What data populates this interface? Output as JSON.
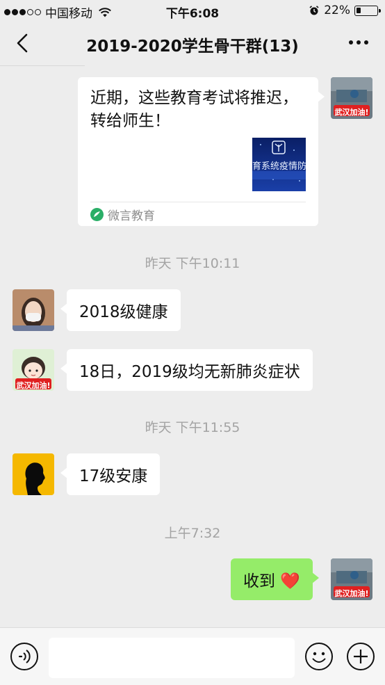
{
  "status_bar": {
    "carrier": "中国移动",
    "time": "下午6:08",
    "battery_text": "22%",
    "battery_level": 0.22
  },
  "nav": {
    "title": "2019-2020学生骨干群(13)"
  },
  "messages": {
    "card": {
      "title": "近期，这些教育考试将推迟，转给师生！",
      "thumb_text": "育系统疫情防",
      "source": "微言教育"
    },
    "timestamp_1": "昨天 下午10:11",
    "msg_1": "2018级健康",
    "msg_2": "18日，2019级均无新肺炎症状",
    "timestamp_2": "昨天 下午11:55",
    "msg_3": "17级安康",
    "timestamp_3": "上午7:32",
    "msg_4": "收到 ❤️",
    "avatar_badge": "武汉加油!"
  },
  "colors": {
    "chat_background": "#ededed",
    "sent_bubble": "#95ec69",
    "received_bubble": "#ffffff",
    "timestamp": "#a3a3a3"
  },
  "icons": {
    "back": "chevron-left-icon",
    "more": "more-dots-icon",
    "voice": "voice-icon",
    "emoji": "emoji-icon",
    "plus": "plus-icon",
    "source": "wechat-leaf-icon"
  }
}
